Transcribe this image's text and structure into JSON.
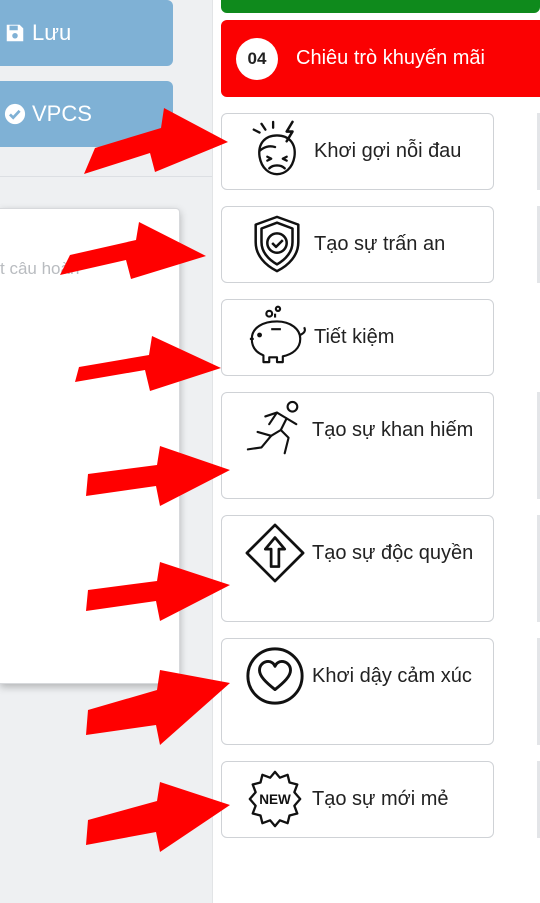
{
  "left_panel": {
    "save_button_label": "Lưu",
    "vpcs_button_label": "VPCS",
    "editor_placeholder": "t câu hoàn"
  },
  "header": {
    "number": "04",
    "title": "Chiêu trò khuyến mãi"
  },
  "tricks": [
    {
      "label": "Khơi gợi nỗi đau",
      "icon": "headache-face-icon"
    },
    {
      "label": "Tạo sự trấn an",
      "icon": "shield-check-icon"
    },
    {
      "label": "Tiết kiệm",
      "icon": "piggy-bank-icon"
    },
    {
      "label": "Tạo sự khan hiếm",
      "icon": "running-person-icon"
    },
    {
      "label": "Tạo sự độc quyền",
      "icon": "up-arrow-sign-icon"
    },
    {
      "label": "Khơi dậy cảm xúc",
      "icon": "heart-circle-icon"
    },
    {
      "label": "Tạo sự mới mẻ",
      "icon": "new-badge-icon"
    }
  ],
  "colors": {
    "header_red": "#fb0102",
    "top_green": "#0f8a1c",
    "side_button_blue": "#7fb1d5",
    "arrow_red": "#ff0000"
  }
}
